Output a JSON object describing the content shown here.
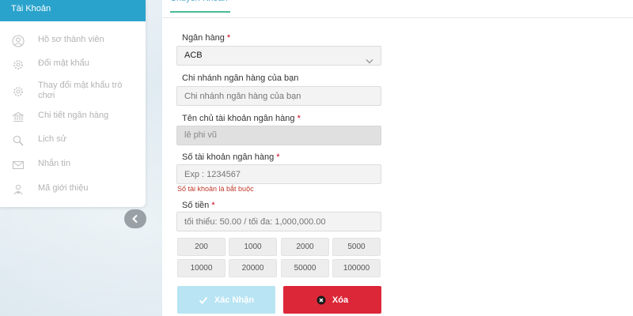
{
  "sidebar": {
    "title": "Tài Khoản",
    "items": [
      {
        "label": "Hồ sơ thành viên",
        "icon": "user-icon"
      },
      {
        "label": "Đổi mật khẩu",
        "icon": "gear-icon"
      },
      {
        "label": "Thay đổi mật khẩu trò chơi",
        "icon": "gear-icon"
      },
      {
        "label": "Chi tiết ngân hàng",
        "icon": "bank-icon"
      },
      {
        "label": "Lịch sử",
        "icon": "search-icon"
      },
      {
        "label": "Nhắn tin",
        "icon": "mail-icon"
      },
      {
        "label": "Mã giới thiệu",
        "icon": "referral-icon"
      }
    ]
  },
  "tab": {
    "label": "Chuyển Khoản Ngân Hàng"
  },
  "form": {
    "bank": {
      "label": "Ngân hàng",
      "value": "ACB"
    },
    "branch": {
      "label": "Chi nhánh ngân hàng của bạn",
      "placeholder": "Chi nhánh ngân hàng của bạn"
    },
    "holder": {
      "label": "Tên chủ tài khoản ngân hàng",
      "value": "lê phi vũ"
    },
    "account": {
      "label": "Số tài khoản ngân hàng",
      "placeholder": "Exp : 1234567",
      "error": "Số tài khoản là bắt buộc"
    },
    "amount": {
      "label": "Số tiền",
      "placeholder": "tối thiểu: 50.00 / tối đa: 1,000,000.00"
    },
    "required_mark": "*",
    "quick_amounts": [
      "200",
      "1000",
      "2000",
      "5000",
      "10000",
      "20000",
      "50000",
      "100000"
    ]
  },
  "buttons": {
    "confirm": "Xác Nhận",
    "delete": "Xóa"
  },
  "colors": {
    "header": "#2aa3cc",
    "confirm": "#b8e4f3",
    "delete": "#dc2739",
    "error": "#c0392b"
  }
}
